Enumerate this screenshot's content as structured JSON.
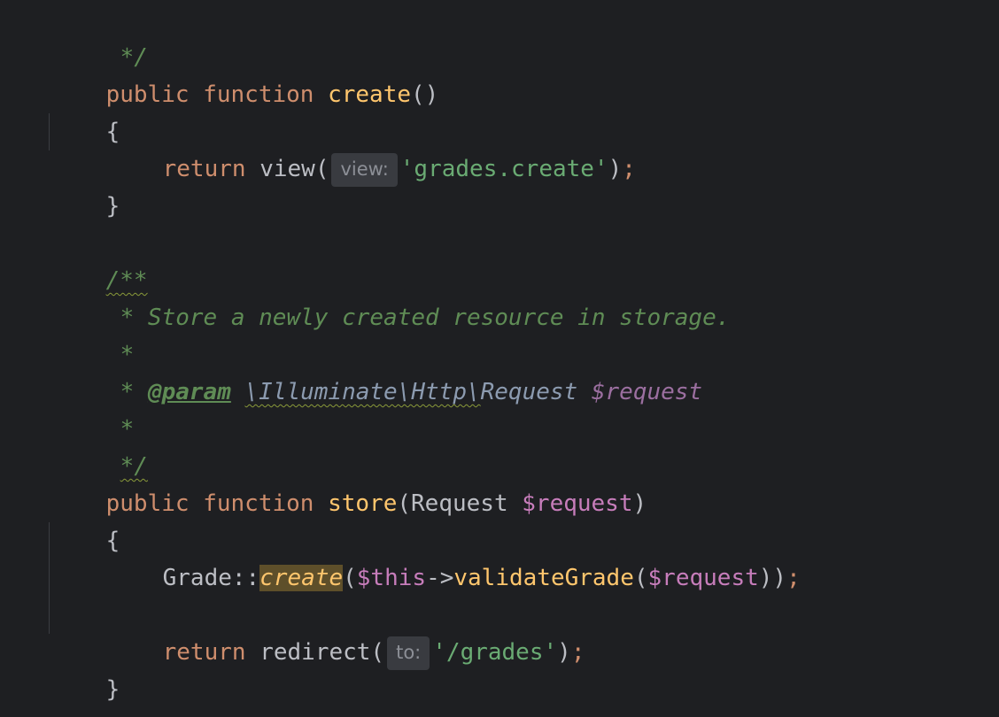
{
  "code": {
    "l1": "*/",
    "l2_kw1": "public",
    "l2_kw2": "function",
    "l2_fn": "create",
    "l2_punct": "()",
    "l3": "{",
    "l4_kw": "return",
    "l4_fn": "view(",
    "l4_hint": "view:",
    "l4_str": "'grades.create'",
    "l4_close": ")",
    "l4_semi": ";",
    "l5": "}",
    "l6": "/**",
    "l7": "* Store a newly created resource in storage.",
    "l8": "*",
    "l9_star": "*",
    "l9_tag": "@param",
    "l9_type_ns": "\\Illuminate\\Http\\",
    "l9_type": "Request",
    "l9_var": "$request",
    "l10": "*",
    "l11": "*/",
    "l12_kw1": "public",
    "l12_kw2": "function",
    "l12_fn": "store",
    "l12_open": "(Request ",
    "l12_var": "$request",
    "l12_close": ")",
    "l13": "{",
    "l14_cls": "Grade::",
    "l14_fn": "create",
    "l14_open": "(",
    "l14_this": "$this",
    "l14_arrow": "->",
    "l14_fn2": "validateGrade",
    "l14_open2": "(",
    "l14_var": "$request",
    "l14_close": "))",
    "l14_semi": ";",
    "l15_kw": "return",
    "l15_fn": "redirect(",
    "l15_hint": "to:",
    "l15_str": "'/grades'",
    "l15_close": ")",
    "l15_semi": ";",
    "l16": "}"
  }
}
